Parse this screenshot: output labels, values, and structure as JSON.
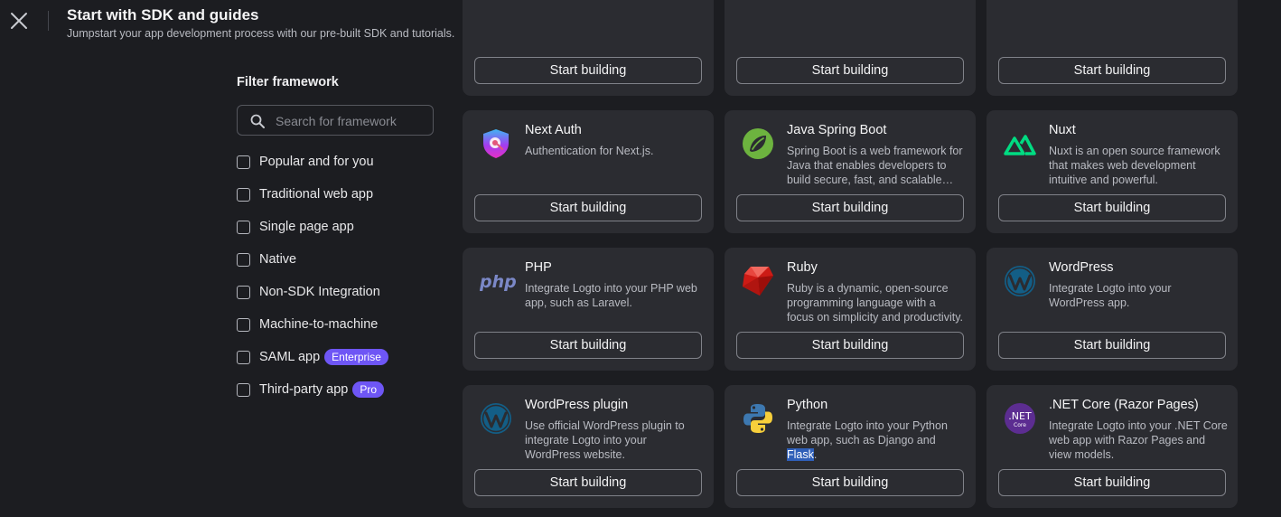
{
  "header": {
    "title": "Start with SDK and guides",
    "subtitle": "Jumpstart your app development process with our pre-built SDK and tutorials."
  },
  "filter": {
    "heading": "Filter framework",
    "search_placeholder": "Search for framework",
    "search_value": "",
    "options": [
      {
        "label": "Popular and for you",
        "checked": false
      },
      {
        "label": "Traditional web app",
        "checked": false
      },
      {
        "label": "Single page app",
        "checked": false
      },
      {
        "label": "Native",
        "checked": false
      },
      {
        "label": "Non-SDK Integration",
        "checked": false
      },
      {
        "label": "Machine-to-machine",
        "checked": false
      },
      {
        "label": "SAML app",
        "checked": false,
        "tag": "Enterprise"
      },
      {
        "label": "Third-party app",
        "checked": false,
        "tag": "Pro"
      }
    ]
  },
  "button_label": "Start building",
  "cards": [
    {
      "name": "",
      "description": "",
      "icon": "unknown-icon"
    },
    {
      "name": "",
      "description": "",
      "icon": "unknown-icon"
    },
    {
      "name": "",
      "description": "",
      "icon": "unknown-icon"
    },
    {
      "name": "Next Auth",
      "description": "Authentication for Next.js.",
      "icon": "next-auth-icon"
    },
    {
      "name": "Java Spring Boot",
      "description": "Spring Boot is a web framework for Java that enables developers to build secure, fast, and scalable server applications.",
      "icon": "spring-boot-icon"
    },
    {
      "name": "Nuxt",
      "description": "Nuxt is an open source framework that makes web development intuitive and powerful.",
      "icon": "nuxt-icon"
    },
    {
      "name": "PHP",
      "description": "Integrate Logto into your PHP web app, such as Laravel.",
      "icon": "php-icon"
    },
    {
      "name": "Ruby",
      "description": "Ruby is a dynamic, open-source programming language with a focus on simplicity and productivity.",
      "icon": "ruby-icon"
    },
    {
      "name": "WordPress",
      "description": "Integrate Logto into your WordPress app.",
      "icon": "wordpress-icon"
    },
    {
      "name": "WordPress plugin",
      "description": "Use official WordPress plugin to integrate Logto into your WordPress website.",
      "icon": "wordpress-icon"
    },
    {
      "name": "Python",
      "description_before": "Integrate Logto into your Python web app, such as Django and ",
      "description_highlight": "Flask",
      "description_after": ".",
      "icon": "python-icon"
    },
    {
      "name": ".NET Core (Razor Pages)",
      "description": "Integrate Logto into your .NET Core web app with Razor Pages and view models.",
      "icon": "dotnet-core-icon"
    }
  ],
  "icon_text": {
    "php": "php",
    "dotnet_top": ".NET",
    "dotnet_bottom": "Core"
  },
  "colors": {
    "accent": "#6e56f5",
    "card_bg": "#2b2c31",
    "page_bg": "#1c1d21",
    "selection": "#2f5fb8"
  }
}
